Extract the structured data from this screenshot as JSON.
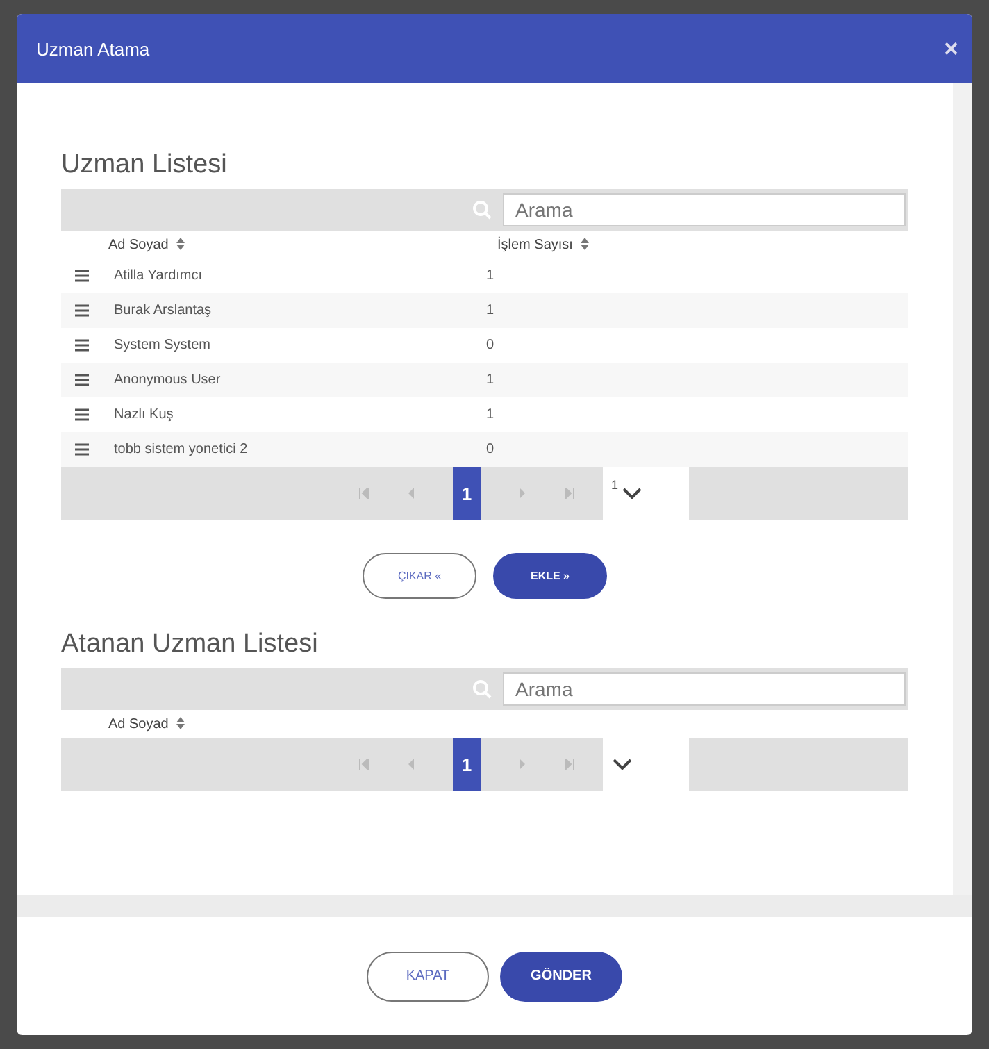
{
  "window": {
    "title": "Uzman Atama",
    "close": "×"
  },
  "expert_list": {
    "title": "Uzman Listesi",
    "search": {
      "placeholder": "Arama"
    },
    "columns": [
      "Ad Soyad",
      "İşlem Sayısı"
    ],
    "rows": [
      {
        "name": "Atilla Yardımcı",
        "count": "1"
      },
      {
        "name": "Burak Arslantaş",
        "count": "1"
      },
      {
        "name": "System System",
        "count": "0"
      },
      {
        "name": "Anonymous User",
        "count": "1"
      },
      {
        "name": "Nazlı Kuş",
        "count": "1"
      },
      {
        "name": "tobb sistem yonetici 2",
        "count": "0"
      }
    ],
    "pager": {
      "page": "1",
      "page_size": "1"
    }
  },
  "transfer_buttons": [
    "ÇIKAR «",
    "EKLE »"
  ],
  "assigned_list": {
    "title": "Atanan Uzman Listesi",
    "search": {
      "placeholder": "Arama"
    },
    "columns": [
      "Ad Soyad"
    ],
    "pager": {
      "page": "1"
    }
  },
  "buttons": [
    "KAPAT",
    "GÖNDER"
  ]
}
